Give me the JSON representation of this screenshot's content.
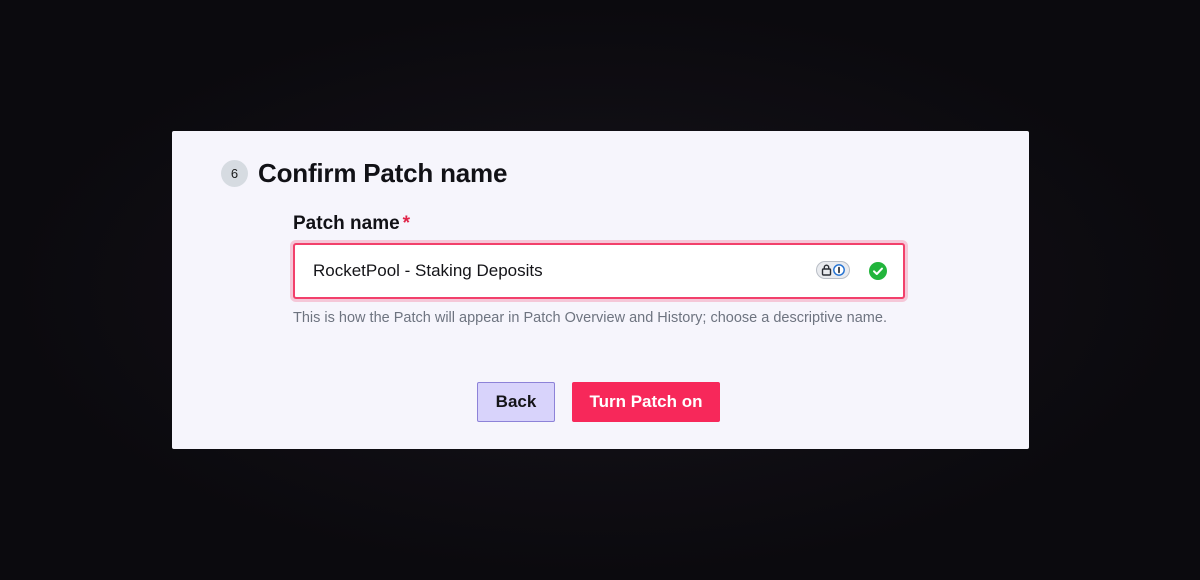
{
  "step": {
    "number": "6",
    "title": "Confirm Patch name"
  },
  "field": {
    "label": "Patch name",
    "required_marker": "*",
    "value": "RocketPool - Staking Deposits",
    "helper": "This is how the Patch will appear in Patch Overview and History; choose a descriptive name."
  },
  "icons": {
    "password_manager": "lock-key-pill-icon",
    "valid": "check-circle-icon"
  },
  "buttons": {
    "back_label": "Back",
    "primary_label": "Turn Patch on"
  },
  "colors": {
    "accent": "#f7285a",
    "input_border": "#f2406b",
    "back_button_bg": "#d8d3fb",
    "valid_green": "#22b53c",
    "card_bg": "#f6f5fc"
  }
}
